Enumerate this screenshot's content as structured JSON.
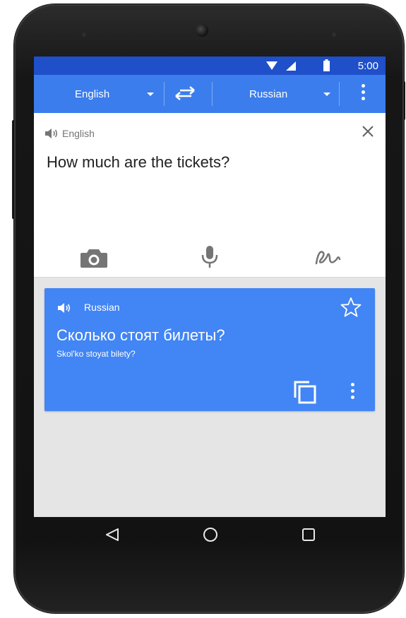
{
  "status_bar": {
    "time": "5:00"
  },
  "language_bar": {
    "source_language": "English",
    "target_language": "Russian"
  },
  "input_card": {
    "language_label": "English",
    "text": "How much are the tickets?"
  },
  "output_card": {
    "language_label": "Russian",
    "translation": "Сколько стоят билеты?",
    "transliteration": "Skol'ko stoyat bilety?"
  },
  "colors": {
    "status_bar": "#1f4fc9",
    "app_bar": "#3b7ded",
    "translation_card": "#4285f4",
    "screen_background": "#e5e5e5"
  },
  "icons": [
    "wifi-icon",
    "cellular-signal-icon",
    "battery-icon",
    "swap-languages-icon",
    "more-options-icon",
    "speaker-icon",
    "close-icon",
    "camera-icon",
    "microphone-icon",
    "handwriting-icon",
    "star-icon",
    "copy-icon",
    "back-icon",
    "home-icon",
    "recent-apps-icon"
  ]
}
